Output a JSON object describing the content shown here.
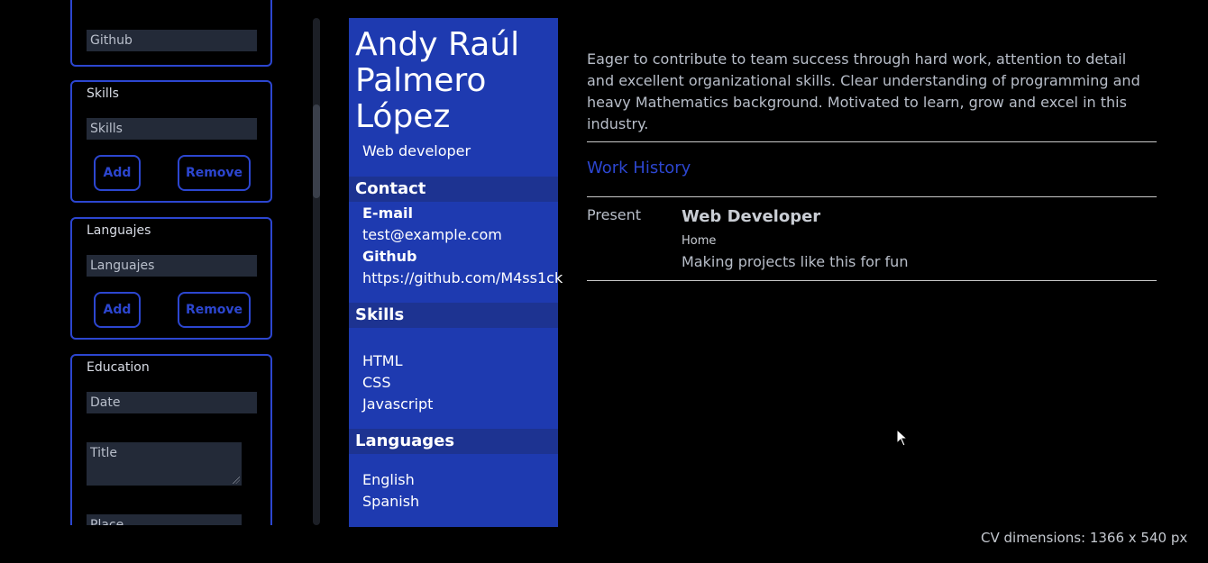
{
  "editor": {
    "github_field": {
      "placeholder": "Github"
    },
    "skills": {
      "label": "Skills",
      "placeholder": "Skills",
      "add": "Add",
      "remove": "Remove"
    },
    "languages": {
      "label": "Languajes",
      "placeholder": "Languajes",
      "add": "Add",
      "remove": "Remove"
    },
    "education": {
      "label": "Education",
      "date_placeholder": "Date",
      "title_placeholder": "Title",
      "place_placeholder": "Place"
    }
  },
  "cv": {
    "name": "Andy Raúl Palmero López",
    "role": "Web developer",
    "contact": {
      "heading": "Contact",
      "email_label": "E-mail",
      "email": "test@example.com",
      "github_label": "Github",
      "github": "https://github.com/M4ss1ck"
    },
    "skills": {
      "heading": "Skills",
      "items": [
        "HTML",
        "CSS",
        "Javascript"
      ]
    },
    "languages": {
      "heading": "Languages",
      "items": [
        "English",
        "Spanish"
      ]
    },
    "summary": "Eager to contribute to team success through hard work, attention to detail and excellent organizational skills. Clear understanding of programming and heavy Mathematics background. Motivated to learn, grow and excel in this industry.",
    "work_history": {
      "heading": "Work History",
      "entries": [
        {
          "date": "Present",
          "title": "Web Developer",
          "company": "Home",
          "description": "Making projects like this for fun"
        }
      ]
    }
  },
  "footer": {
    "dimensions": "CV dimensions: 1366 x 540 px"
  },
  "colors": {
    "accent": "#2c46d0",
    "cv_sidebar": "#1e3ab0",
    "background": "#000000"
  }
}
